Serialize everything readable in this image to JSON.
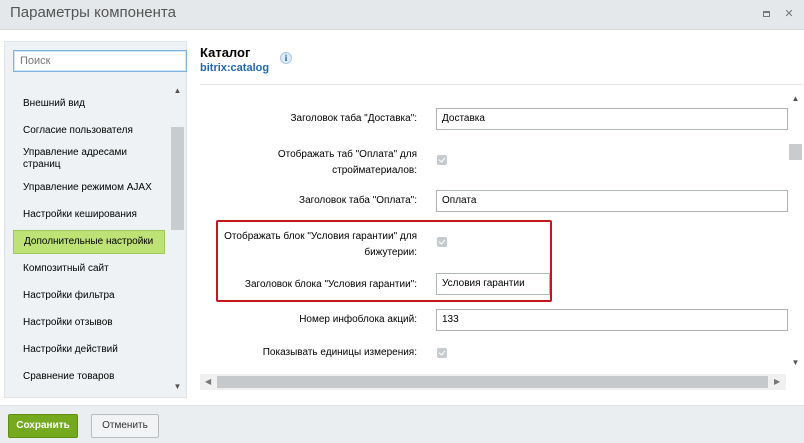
{
  "window": {
    "title": "Параметры компонента"
  },
  "sidebar": {
    "search_placeholder": "Поиск",
    "items": [
      {
        "label": "Внешний вид"
      },
      {
        "label": "Согласие пользователя"
      },
      {
        "label": "Управление адресами страниц"
      },
      {
        "label": "Управление режимом AJAX"
      },
      {
        "label": "Настройки кеширования"
      },
      {
        "label": "Дополнительные настройки",
        "active": true
      },
      {
        "label": "Композитный сайт"
      },
      {
        "label": "Настройки фильтра"
      },
      {
        "label": "Настройки отзывов"
      },
      {
        "label": "Настройки действий"
      },
      {
        "label": "Сравнение товаров"
      }
    ]
  },
  "main": {
    "title": "Каталог",
    "subtitle": "bitrix:catalog",
    "info_icon": "info-icon",
    "fields": [
      {
        "label": "Заголовок таба \"Доставка\":",
        "type": "text",
        "value": "Доставка"
      },
      {
        "label": "Отображать таб \"Оплата\" для стройматериалов:",
        "type": "checkbox",
        "checked": true
      },
      {
        "label": "Заголовок таба \"Оплата\":",
        "type": "text",
        "value": "Оплата"
      },
      {
        "label": "Отображать блок \"Условия гарантии\" для бижутерии:",
        "type": "checkbox",
        "checked": true
      },
      {
        "label": "Заголовок блока \"Условия гарантии\":",
        "type": "text",
        "value": "Условия гарантии"
      },
      {
        "label": "Номер инфоблока акций:",
        "type": "text",
        "value": "133"
      },
      {
        "label": "Показывать единицы измерения:",
        "type": "checkbox",
        "checked": true
      }
    ]
  },
  "footer": {
    "save_label": "Сохранить",
    "cancel_label": "Отменить"
  },
  "colors": {
    "accent_green": "#75a91e",
    "active_item": "#bee276",
    "highlight_red": "#c4171d",
    "link_blue": "#2067b0"
  }
}
